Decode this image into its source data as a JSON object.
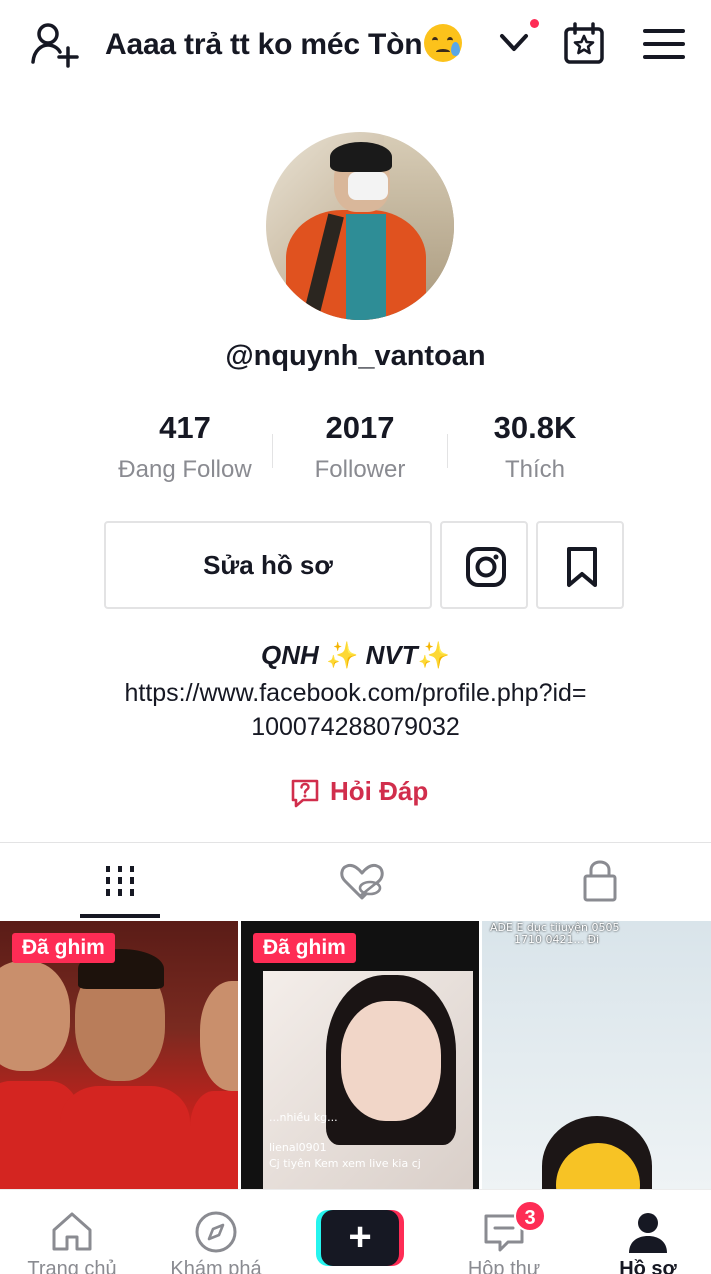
{
  "header": {
    "username_title": "Aaaa trả tt ko méc Tòn",
    "title_emoji": "crying-face-emoji"
  },
  "profile": {
    "handle": "@nquynh_vantoan",
    "stats": [
      {
        "value": "417",
        "label": "Đang Follow"
      },
      {
        "value": "2017",
        "label": "Follower"
      },
      {
        "value": "30.8K",
        "label": "Thích"
      }
    ],
    "edit_button": "Sửa hồ sơ",
    "bio_name_1": "QNH",
    "bio_name_2": "NVT",
    "bio_sparkle": "✨",
    "bio_link_line1": "https://www.facebook.com/profile.php?id=",
    "bio_link_line2": "100074288079032",
    "qa_label": "Hỏi Đáp"
  },
  "tabs": [
    {
      "icon": "grid-icon",
      "active": true
    },
    {
      "icon": "liked-hidden-icon",
      "active": false
    },
    {
      "icon": "lock-icon",
      "active": false
    }
  ],
  "videos": [
    {
      "pinned_label": "Đã ghim"
    },
    {
      "pinned_label": "Đã ghim",
      "chat_lines": [
        "...nhiều kg...",
        "lienal0901",
        "Cj tiyên Kem xem live kia cj"
      ]
    },
    {
      "overlay_line1": "ADE E dục tiiuyện 0505",
      "overlay_line2": "1710 0421... Đi"
    }
  ],
  "bottom_nav": {
    "home": "Trang chủ",
    "explore": "Khám phá",
    "inbox": "Hộp thư",
    "inbox_badge": "3",
    "profile": "Hồ sơ",
    "create_symbol": "+"
  },
  "colors": {
    "accent": "#fe2c55",
    "qa_red": "#d12e4c",
    "text": "#161823",
    "muted": "#8a8b91",
    "create_cyan": "#25f4ee"
  }
}
